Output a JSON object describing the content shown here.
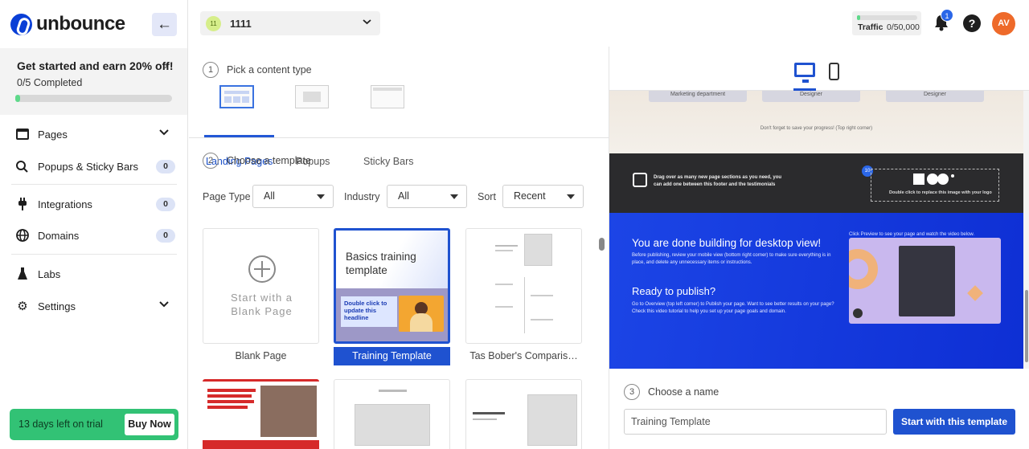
{
  "brand": {
    "name": "unbounce",
    "accent": "#1f52d0"
  },
  "sidebar": {
    "promo": {
      "title": "Get started and earn 20% off!",
      "progress_text": "0/5 Completed",
      "progress": 0.03
    },
    "items": [
      {
        "label": "Pages",
        "icon": "pages-icon",
        "chevron": true
      },
      {
        "label": "Popups & Sticky Bars",
        "icon": "popups-icon",
        "badge": "0"
      },
      {
        "label": "Integrations",
        "icon": "plug-icon",
        "badge": "0"
      },
      {
        "label": "Domains",
        "icon": "globe-icon",
        "badge": "0"
      },
      {
        "label": "Labs",
        "icon": "flask-icon"
      },
      {
        "label": "Settings",
        "icon": "gear-icon",
        "chevron": true
      }
    ],
    "trial": {
      "text": "13 days left on trial",
      "buy_label": "Buy Now"
    }
  },
  "header": {
    "workspace": {
      "avatar": "11",
      "name": "1111"
    },
    "traffic": {
      "label": "Traffic",
      "value": "0/50,000",
      "progress": 0.0
    },
    "notifications_count": "1",
    "help": "?",
    "user_initials": "AV"
  },
  "builder": {
    "step1": {
      "num": "1",
      "label": "Pick a content type"
    },
    "content_types": [
      {
        "label": "Landing Pages",
        "active": true
      },
      {
        "label": "Popups",
        "active": false
      },
      {
        "label": "Sticky Bars",
        "active": false
      }
    ],
    "step2": {
      "num": "2",
      "label": "Choose a template"
    },
    "filters": {
      "page_type_label": "Page Type",
      "page_type_value": "All",
      "industry_label": "Industry",
      "industry_value": "All",
      "sort_label": "Sort",
      "sort_value": "Recent"
    },
    "templates": [
      {
        "caption": "Blank Page",
        "thumb_text": "Start with a Blank Page"
      },
      {
        "caption": "Training Template",
        "selected": true,
        "thumb_title": "Basics training template",
        "thumb_sub": "Double click to update this headline"
      },
      {
        "caption": "Tas Bober's Comparis…"
      }
    ],
    "step3": {
      "num": "3",
      "label": "Choose a name",
      "name_value": "Training Template"
    },
    "start_label": "Start with this template"
  },
  "preview": {
    "chips": [
      "Marketing department",
      "Designer",
      "Designer"
    ],
    "save_note": "Don't forget to save your progress! (Top right corner)",
    "dark_text": "Drag over as many new page sections as you need, you can add one between this footer and the testimonials",
    "logo_num": "10",
    "logo_caption": "Double click to replace this image with your logo",
    "heading1": "You are done building for desktop view!",
    "para1": "Before publishing, review your mobile view (bottom right corner) to make sure everything is in place, and delete any unnecessary items or instructions.",
    "heading2": "Ready to publish?",
    "para2": "Go to Overview (top left corner) to Publish your page. Want to see better results on your page? Check this video tutorial to help you set up your page goals and domain.",
    "click_text": "Click  Preview  to see your page and watch the video below."
  }
}
